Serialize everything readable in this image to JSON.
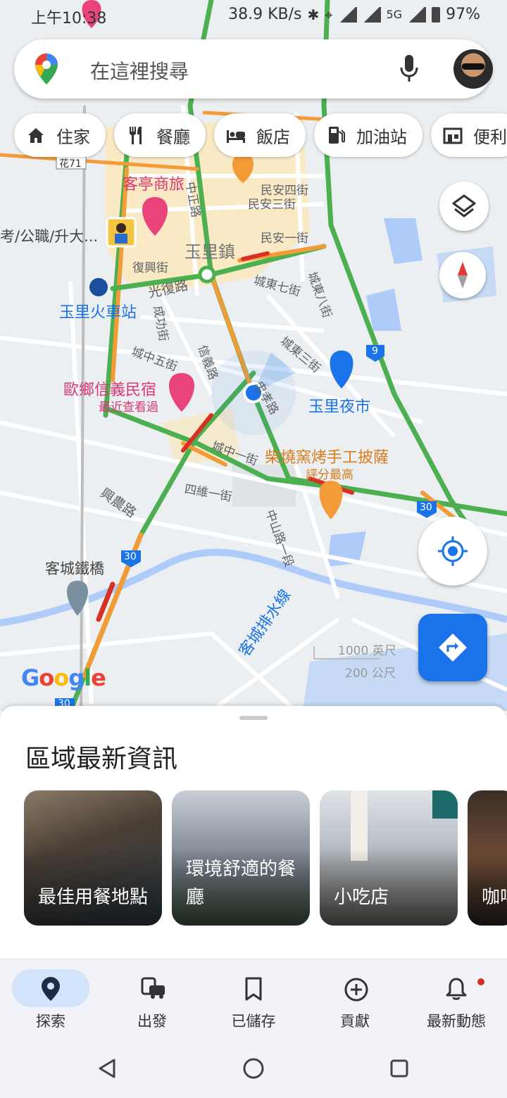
{
  "status_bar": {
    "time": "上午10:38",
    "speed": "38.9 KB/s",
    "battery": "97%"
  },
  "search": {
    "placeholder": "在這裡搜尋",
    "icons": [
      "google-maps-pin-icon",
      "microphone-icon",
      "avatar"
    ]
  },
  "chips": [
    {
      "label": "住家",
      "icon": "home-icon"
    },
    {
      "label": "餐廳",
      "icon": "restaurant-icon"
    },
    {
      "label": "飯店",
      "icon": "hotel-icon"
    },
    {
      "label": "加油站",
      "icon": "gas-station-icon"
    },
    {
      "label": "便利",
      "icon": "store-icon"
    }
  ],
  "map": {
    "labels": {
      "town": "玉里鎮",
      "hotel_kt": "客亭商旅",
      "cram": "考/公職/升大...",
      "station": "玉里火車站",
      "bnb": "歐鄉信義民宿",
      "bnb_sub": "最近查看過",
      "night_market": "玉里夜市",
      "pizza": "柴燒窯烤手工披薩",
      "pizza_sub": "評分最高",
      "bridge": "客城鐵橋",
      "drain": "客城排水線",
      "xingnong": "興農路",
      "guangfu": "光復路",
      "fuxing": "復興街",
      "chengzhong5": "城中五街",
      "chengzhong1": "城中一街",
      "siwei1": "四維一街",
      "zhongshan1": "中山路一段",
      "chengdong7": "城東七街",
      "chengdong8": "城東八街",
      "chengdong3": "城東三街",
      "minan4": "民安四街",
      "minan3": "民安三街",
      "minan1": "民安一街",
      "zhongzheng": "中正路",
      "xinyi": "信義路",
      "chenggong": "成功街",
      "zhongxiao": "忠孝路",
      "hua71": "花71",
      "route9": "9",
      "route30a": "30",
      "route30b": "30",
      "route30c": "30",
      "scale_ft": "1000 英尺",
      "scale_m": "200 公尺",
      "google": "Google"
    }
  },
  "sheet": {
    "title": "區域最新資訊",
    "cards": [
      {
        "label": "最佳用餐地點"
      },
      {
        "label": "環境舒適的餐廳"
      },
      {
        "label": "小吃店"
      },
      {
        "label": "咖啡"
      }
    ]
  },
  "nav": [
    {
      "label": "探索",
      "icon": "explore-pin-icon",
      "active": true
    },
    {
      "label": "出發",
      "icon": "commute-icon"
    },
    {
      "label": "已儲存",
      "icon": "bookmark-icon"
    },
    {
      "label": "貢獻",
      "icon": "add-circle-icon"
    },
    {
      "label": "最新動態",
      "icon": "bell-icon"
    }
  ],
  "colors": {
    "accent": "#1a73e8",
    "traffic_green": "#4caf50",
    "traffic_orange": "#f29b37",
    "traffic_red": "#d93025"
  }
}
